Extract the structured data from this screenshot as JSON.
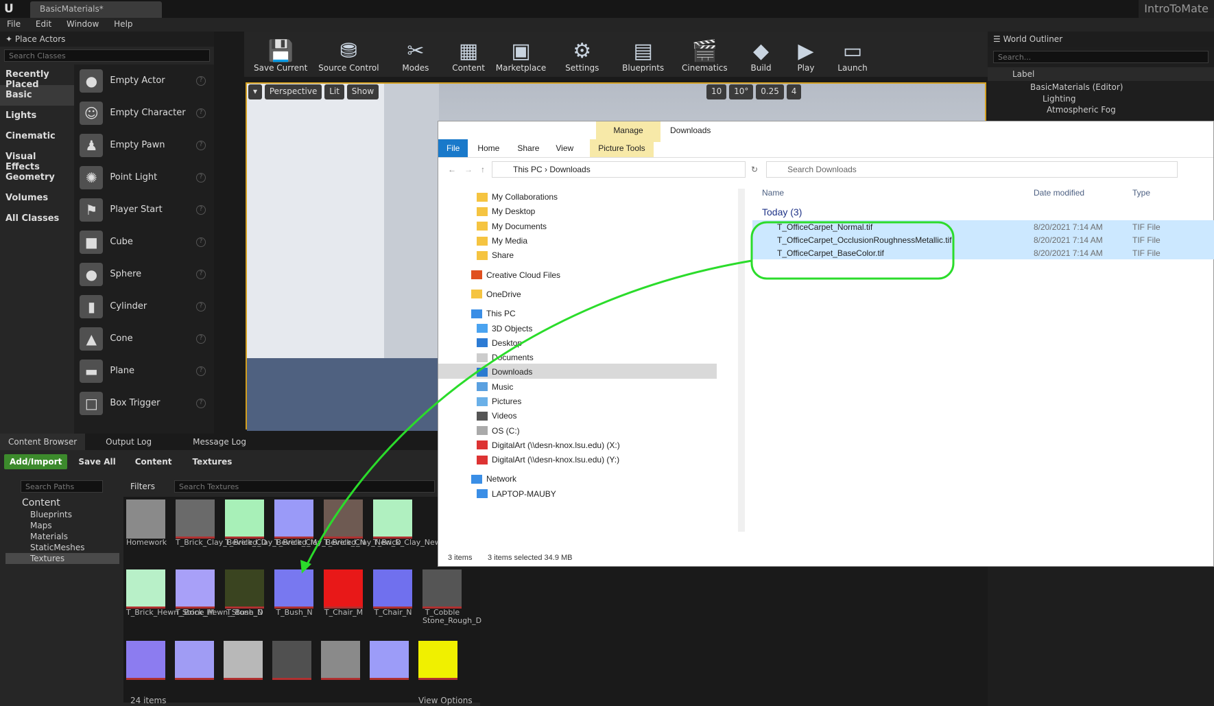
{
  "app": {
    "doc_tab": "BasicMaterials*",
    "project": "IntroToMate"
  },
  "menu": [
    "File",
    "Edit",
    "Window",
    "Help"
  ],
  "place_actors": {
    "title": "Place Actors",
    "search_placeholder": "Search Classes",
    "categories": [
      "Recently Placed",
      "Basic",
      "Lights",
      "Cinematic",
      "Visual Effects",
      "Geometry",
      "Volumes",
      "All Classes"
    ],
    "items": [
      {
        "label": "Empty Actor",
        "icon": "sphere-icon"
      },
      {
        "label": "Empty Character",
        "icon": "character-icon"
      },
      {
        "label": "Empty Pawn",
        "icon": "pawn-icon"
      },
      {
        "label": "Point Light",
        "icon": "bulb-icon"
      },
      {
        "label": "Player Start",
        "icon": "flag-icon"
      },
      {
        "label": "Cube",
        "icon": "cube-icon"
      },
      {
        "label": "Sphere",
        "icon": "sphere-icon"
      },
      {
        "label": "Cylinder",
        "icon": "cylinder-icon"
      },
      {
        "label": "Cone",
        "icon": "cone-icon"
      },
      {
        "label": "Plane",
        "icon": "plane-icon"
      },
      {
        "label": "Box Trigger",
        "icon": "box-icon"
      }
    ]
  },
  "toolbar": [
    "Save Current",
    "Source Control",
    "Modes",
    "Content",
    "Marketplace",
    "Settings",
    "Blueprints",
    "Cinematics",
    "Build",
    "Play",
    "Launch"
  ],
  "viewport": {
    "perspective": "Perspective",
    "lit": "Lit",
    "show": "Show",
    "grid": "10",
    "rot": "10°",
    "scale": "0.25",
    "cam": "4"
  },
  "outliner": {
    "title": "World Outliner",
    "search": "Search...",
    "col": "Label",
    "rows": [
      "BasicMaterials (Editor)",
      "Lighting",
      "Atmospheric Fog"
    ]
  },
  "explorer": {
    "manage": "Manage",
    "title": "Downloads",
    "ribbon": [
      "File",
      "Home",
      "Share",
      "View"
    ],
    "picture_tools": "Picture Tools",
    "path": [
      "This PC",
      "Downloads"
    ],
    "search": "Search Downloads",
    "nav": [
      "My Collaborations",
      "My Desktop",
      "My Documents",
      "My Media",
      "Share",
      "Creative Cloud Files",
      "OneDrive",
      "This PC",
      "3D Objects",
      "Desktop",
      "Documents",
      "Downloads",
      "Music",
      "Pictures",
      "Videos",
      "OS (C:)",
      "DigitalArt (\\\\desn-knox.lsu.edu) (X:)",
      "DigitalArt (\\\\desn-knox.lsu.edu) (Y:)",
      "Network",
      "LAPTOP-MAUBY"
    ],
    "cols": [
      "Name",
      "Date modified",
      "Type"
    ],
    "group": "Today (3)",
    "files": [
      {
        "name": "T_OfficeCarpet_Normal.tif",
        "date": "8/20/2021 7:14 AM",
        "type": "TIF File"
      },
      {
        "name": "T_OfficeCarpet_OcclusionRoughnessMetallic.tif",
        "date": "8/20/2021 7:14 AM",
        "type": "TIF File"
      },
      {
        "name": "T_OfficeCarpet_BaseColor.tif",
        "date": "8/20/2021 7:14 AM",
        "type": "TIF File"
      }
    ],
    "status_items": "3 items",
    "status_sel": "3 items selected  34.9 MB"
  },
  "content_browser": {
    "tabs": [
      "Content Browser",
      "Output Log",
      "Message Log"
    ],
    "add": "Add/Import",
    "save": "Save All",
    "crumbs": [
      "Content",
      "Textures"
    ],
    "search_paths": "Search Paths",
    "filters": "Filters",
    "search_textures": "Search Textures",
    "tree": [
      "Content",
      "Blueprints",
      "Maps",
      "Materials",
      "StaticMeshes",
      "Textures"
    ],
    "assets_r1": [
      "Homework",
      "T_Brick_Clay_Beveled_D",
      "T_Brick_Clay_Beveled_M",
      "T_Brick_Clay_Beveled_N",
      "T_Brick_Clay_New_D",
      "T_Brick_Clay_New_M",
      "T_Br"
    ],
    "assets_r2": [
      "T_Brick_Hewn_Stone_M",
      "T_Brick_Hewn_Stone_N",
      "T_Bush_D",
      "T_Bush_N",
      "T_Chair_M",
      "T_Chair_N",
      "T_Cobble Stone_Rough_D"
    ],
    "count": "24 items",
    "view_options": "View Options"
  },
  "colors": {
    "accent": "#2bdc2b",
    "selection": "#cce8ff",
    "ue_bg": "#262626"
  }
}
